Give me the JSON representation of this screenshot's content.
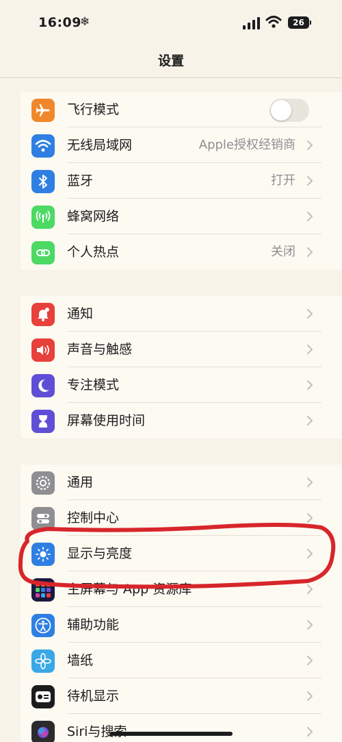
{
  "status_bar": {
    "time": "16:09",
    "weather_glyph": "❄",
    "battery_level": "26"
  },
  "nav": {
    "title": "设置"
  },
  "colors": {
    "airplane": "#f0882b",
    "wifi": "#2f7fe3",
    "bluetooth": "#2f7fe3",
    "cellular": "#4cd964",
    "hotspot": "#4cd964",
    "notifications": "#e8403a",
    "sounds": "#e8403a",
    "focus": "#5f4fd6",
    "screen_time": "#5f4fd6",
    "general": "#8e8e93",
    "control_center": "#8e8e93",
    "display": "#2f7fe3",
    "home_screen": "#7b4fd6",
    "accessibility": "#2f7fe3",
    "wallpaper": "#3aa7e6",
    "standby": "#1c1c1e",
    "siri": "#2b2b2e",
    "annotation_stroke": "#d7262b"
  },
  "sections": [
    {
      "items": [
        {
          "key": "airplane",
          "label": "飞行模式",
          "icon": "airplane-icon",
          "toggle_on": false
        },
        {
          "key": "wifi",
          "label": "无线局域网",
          "value": "Apple授权经销商",
          "icon": "wifi-icon"
        },
        {
          "key": "bluetooth",
          "label": "蓝牙",
          "value": "打开",
          "icon": "bluetooth-icon"
        },
        {
          "key": "cellular",
          "label": "蜂窝网络",
          "icon": "cellular-icon"
        },
        {
          "key": "hotspot",
          "label": "个人热点",
          "value": "关闭",
          "icon": "hotspot-icon"
        }
      ]
    },
    {
      "items": [
        {
          "key": "notifications",
          "label": "通知",
          "icon": "bell-icon"
        },
        {
          "key": "sounds",
          "label": "声音与触感",
          "icon": "speaker-icon"
        },
        {
          "key": "focus",
          "label": "专注模式",
          "icon": "moon-icon"
        },
        {
          "key": "screen_time",
          "label": "屏幕使用时间",
          "icon": "hourglass-icon"
        }
      ]
    },
    {
      "items": [
        {
          "key": "general",
          "label": "通用",
          "icon": "gear-icon"
        },
        {
          "key": "control_center",
          "label": "控制中心",
          "icon": "toggles-icon"
        },
        {
          "key": "display",
          "label": "显示与亮度",
          "icon": "sun-icon"
        },
        {
          "key": "home_screen",
          "label": "主屏幕与 App 资源库",
          "icon": "app-grid-icon"
        },
        {
          "key": "accessibility",
          "label": "辅助功能",
          "icon": "accessibility-icon"
        },
        {
          "key": "wallpaper",
          "label": "墙纸",
          "icon": "flower-icon"
        },
        {
          "key": "standby",
          "label": "待机显示",
          "icon": "standby-icon"
        },
        {
          "key": "siri",
          "label": "Siri与搜索",
          "icon": "siri-icon"
        }
      ]
    }
  ]
}
